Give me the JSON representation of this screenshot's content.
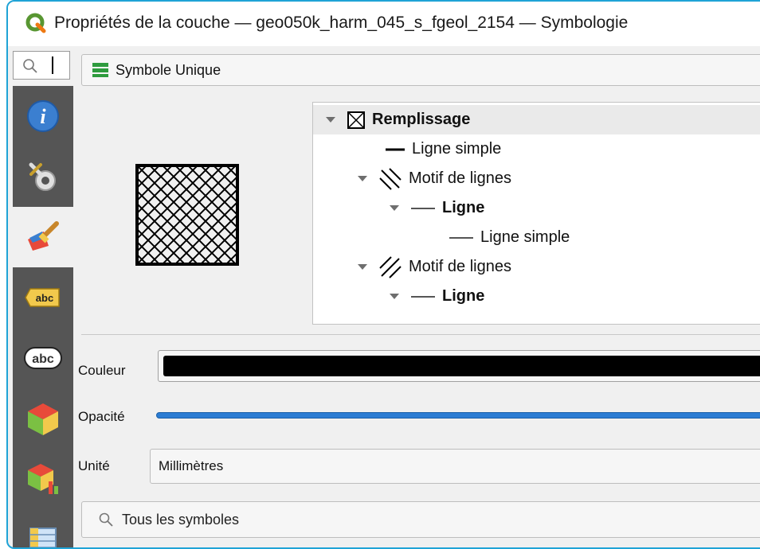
{
  "window": {
    "title": "Propriétés de la couche — geo050k_harm_045_s_fgeol_2154 — Symbologie",
    "border_color": "#1fa3d6"
  },
  "search": {
    "placeholder": ""
  },
  "sidebar": {
    "items": [
      {
        "icon": "info-icon",
        "active": false
      },
      {
        "icon": "source-settings-icon",
        "active": false
      },
      {
        "icon": "symbology-brush-icon",
        "active": true
      },
      {
        "icon": "labels-icon",
        "active": false
      },
      {
        "icon": "mask-labels-icon",
        "active": false
      },
      {
        "icon": "3d-view-icon",
        "active": false
      },
      {
        "icon": "diagrams-icon",
        "active": false
      },
      {
        "icon": "fields-icon",
        "active": false
      }
    ]
  },
  "renderer": {
    "label": "Symbole Unique"
  },
  "symbol_tree": [
    {
      "label": "Remplissage",
      "bold": true,
      "level": 0,
      "expanded": true,
      "selected": true,
      "icon": "fill-cross-icon"
    },
    {
      "label": "Ligne simple",
      "bold": false,
      "level": 1,
      "expanded": null,
      "icon": "line-thick-icon"
    },
    {
      "label": "Motif de lignes",
      "bold": false,
      "level": 1,
      "expanded": true,
      "icon": "line-pattern-back-icon"
    },
    {
      "label": "Ligne",
      "bold": true,
      "level": 2,
      "expanded": true,
      "icon": "line-icon"
    },
    {
      "label": "Ligne simple",
      "bold": false,
      "level": 3,
      "expanded": null,
      "icon": "line-icon"
    },
    {
      "label": "Motif de lignes",
      "bold": false,
      "level": 1,
      "expanded": true,
      "icon": "line-pattern-forward-icon"
    },
    {
      "label": "Ligne",
      "bold": true,
      "level": 2,
      "expanded": true,
      "icon": "line-icon"
    }
  ],
  "properties": {
    "color_label": "Couleur",
    "color_value": "#000000",
    "opacity_label": "Opacité",
    "opacity_value": 1.0,
    "unit_label": "Unité",
    "unit_value": "Millimètres"
  },
  "symbols_search": {
    "text": "Tous les symboles"
  }
}
